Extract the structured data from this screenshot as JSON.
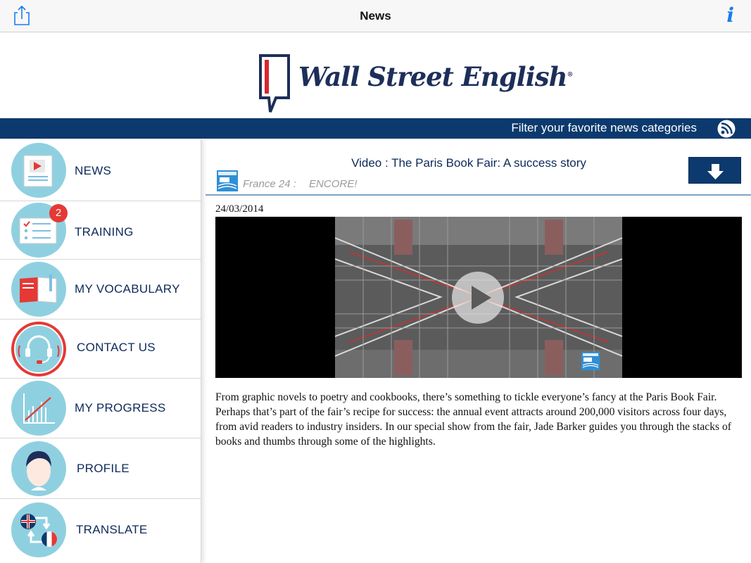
{
  "topbar": {
    "title": "News",
    "share_icon": "share-icon",
    "info_label": "i"
  },
  "logo": {
    "text": "Wall Street English",
    "trademark": "®"
  },
  "filter": {
    "label": "Filter your favorite news categories",
    "icon": "rss-icon"
  },
  "sidebar": {
    "items": [
      {
        "label": "NEWS",
        "icon": "news-video-icon"
      },
      {
        "label": "TRAINING",
        "icon": "training-checklist-icon",
        "badge": "2"
      },
      {
        "label": "MY VOCABULARY",
        "icon": "vocabulary-book-icon"
      },
      {
        "label": "CONTACT US",
        "icon": "headset-icon"
      },
      {
        "label": "MY PROGRESS",
        "icon": "progress-chart-icon"
      },
      {
        "label": "PROFILE",
        "icon": "profile-avatar-icon"
      },
      {
        "label": "TRANSLATE",
        "icon": "translate-flags-icon"
      }
    ]
  },
  "article": {
    "title": "Video : The Paris Book Fair: A success story",
    "source": "France 24 :",
    "program": "ENCORE!",
    "date": "24/03/2014",
    "body": "From graphic novels to poetry and cookbooks, there’s something to tickle everyone’s fancy at the Paris Book Fair. Perhaps that’s part of the fair’s recipe for success: the annual event attracts around 200,000 visitors across four days, from avid readers to industry insiders. In our special show from the fair, Jade Barker guides you through the stacks of books and thumbs through some of the highlights."
  },
  "colors": {
    "navy": "#0c3a6e",
    "nav_text": "#0d2a5a",
    "icon_circle": "#8fd0e0",
    "badge": "#e53935",
    "info_blue": "#1a7cf0",
    "logo_red": "#d8262e"
  }
}
